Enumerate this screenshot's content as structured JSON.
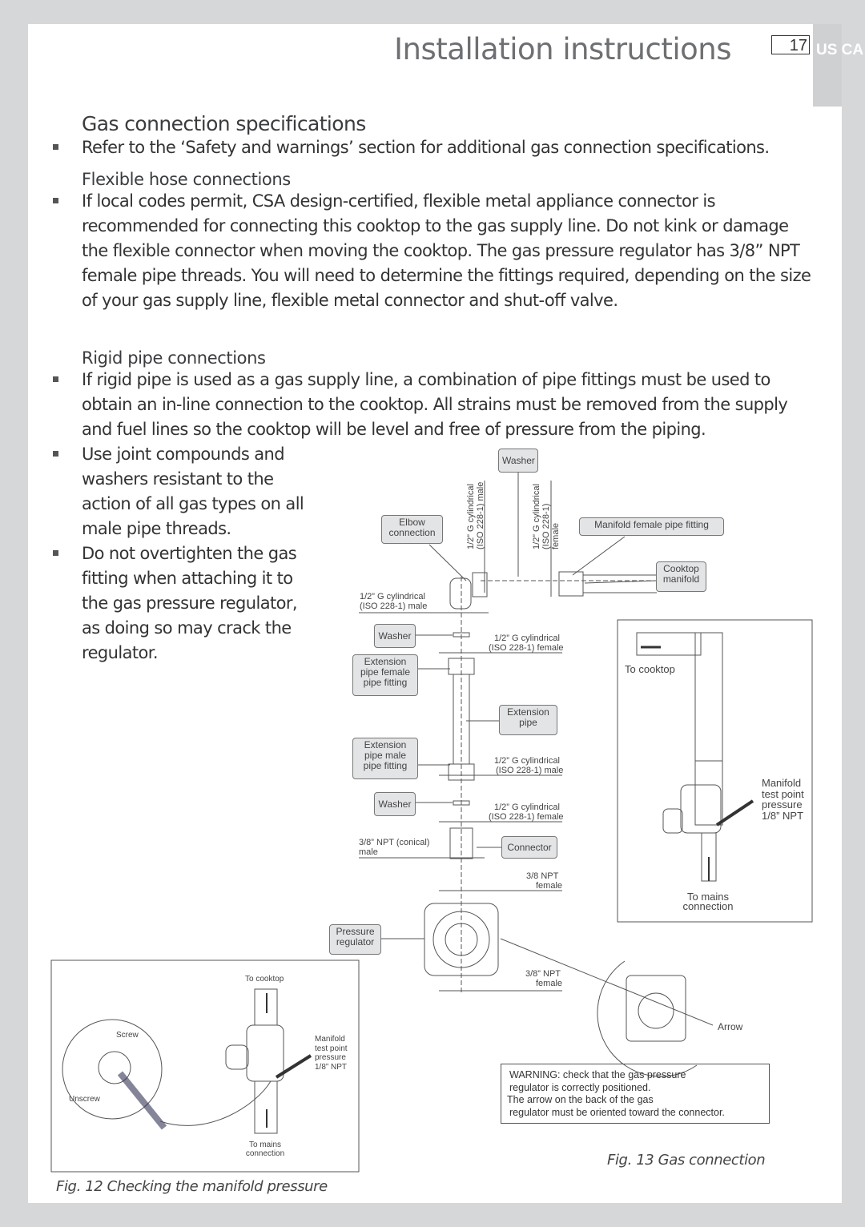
{
  "header": {
    "title": "Installation instructions",
    "page_number": "17",
    "region_tab": "US CA"
  },
  "section": {
    "heading": "Gas connection specifications",
    "intro": "Refer to the ‘Safety and warnings’ section for additional gas connection specifications.",
    "flexible": {
      "heading": "Flexible hose connections",
      "text": "If local codes permit, CSA design-certified, flexible metal appliance connector is recommended for connecting this cooktop to the gas supply line. Do not kink or damage the flexible connector when moving the cooktop. The gas pressure regulator has 3/8” NPT female pipe threads. You will need to determine the fittings required, depending on the size of your gas supply line, flexible metal connector and shut-off valve."
    },
    "rigid": {
      "heading": "Rigid pipe connections",
      "items": [
        "If rigid pipe is used as a gas supply line, a combination of pipe fittings must be used to obtain an in-line connection to the cooktop. All strains must be removed from the supply and fuel lines so the cooktop will be level and free of pressure from the piping.",
        "Use joint compounds and washers resistant to the action of all gas types on all male pipe threads.",
        "Do not overtighten the gas fitting when attaching it to the gas pressure regulator, as doing so may crack the regulator."
      ]
    }
  },
  "fig13": {
    "caption": "Fig. 13 Gas connection",
    "labels": {
      "washer_top": "Washer",
      "elbow": "Elbow connection",
      "manifold_female": "Manifold female pipe fitting",
      "cooktop_manifold": "Cooktop manifold",
      "washer_1": "Washer",
      "ext_female": "Extension pipe female pipe fitting",
      "ext_pipe": "Extension pipe",
      "ext_male": "Extension pipe male pipe fitting",
      "washer_2": "Washer",
      "connector": "Connector",
      "pressure_regulator": "Pressure regulator"
    },
    "dims": {
      "v_male": "1/2” G cylindrical (ISO 228-1) male",
      "v_female": "1/2” G cylindrical (ISO 228-1) female",
      "elbow_male_1": "1/2” G cylindrical",
      "elbow_male_2": "(ISO 228-1) male",
      "f1_1": "1/2” G cylindrical",
      "f1_2": "(ISO 228-1) female",
      "m2_1": "1/2” G cylindrical",
      "m2_2": "(ISO 228-1) male",
      "f3_1": "1/2” G cylindrical",
      "f3_2": "(ISO 228-1) female",
      "npt_conical_1": "3/8” NPT (conical)",
      "npt_conical_2": "male",
      "npt_f1_1": "3/8  NPT",
      "npt_f1_2": "female",
      "npt_f2_1": "3/8” NPT",
      "npt_f2_2": "female",
      "arrow": "Arrow"
    },
    "inset": {
      "to_cooktop": "To cooktop",
      "manifold_1": "Manifold",
      "manifold_2": "test point",
      "manifold_3": "pressure",
      "manifold_4": "1/8” NPT",
      "mains_1": "To mains",
      "mains_2": "connection"
    },
    "warning": [
      "WARNING: check that the gas pressure",
      "regulator is correctly positioned.",
      "The arrow on the back of the gas",
      "regulator must be oriented toward the connector."
    ]
  },
  "fig12": {
    "caption": "Fig. 12 Checking the manifold pressure",
    "to_cooktop": "To cooktop",
    "screw": "Screw",
    "unscrew": "Unscrew",
    "manifold": [
      "Manifold",
      "test point",
      "pressure",
      "1/8” NPT"
    ],
    "mains": [
      "To mains",
      "connection"
    ]
  }
}
